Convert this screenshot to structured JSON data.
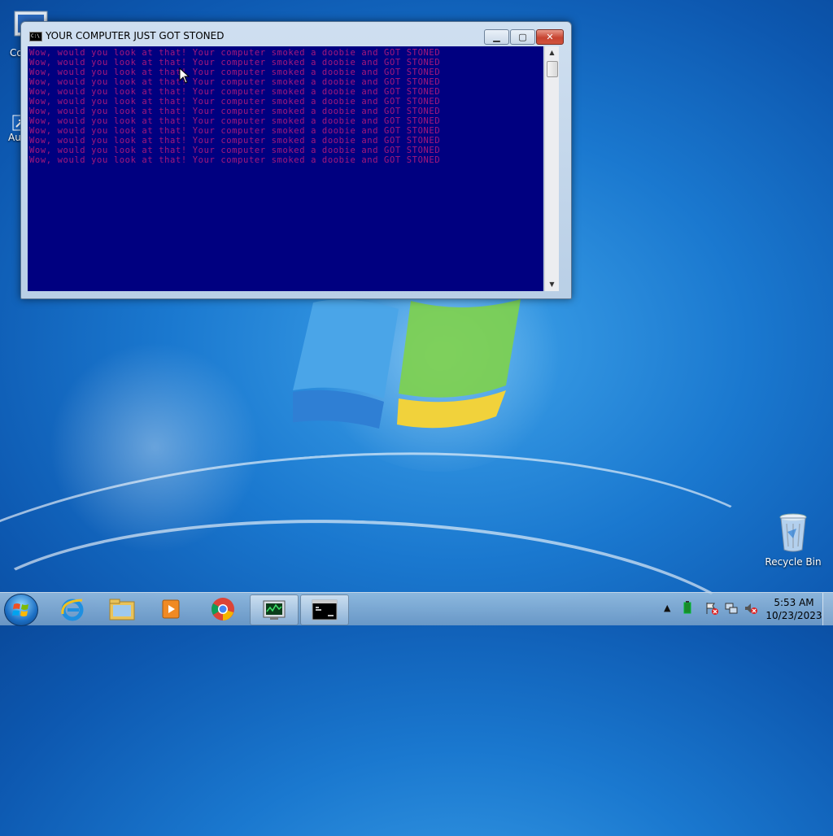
{
  "desktop": {
    "icons": [
      {
        "label": "Co"
      },
      {
        "label": "Au"
      },
      {
        "label": "Recycle Bin"
      }
    ]
  },
  "window": {
    "title": "YOUR COMPUTER JUST GOT STONED",
    "console_text_color": "#a4187c",
    "console_bg_color": "#000080",
    "lines": [
      "Wow, would you look at that! Your computer smoked a doobie and GOT STONED",
      "Wow, would you look at that! Your computer smoked a doobie and GOT STONED",
      "Wow, would you look at that! Your computer smoked a doobie and GOT STONED",
      "Wow, would you look at that! Your computer smoked a doobie and GOT STONED",
      "Wow, would you look at that! Your computer smoked a doobie and GOT STONED",
      "Wow, would you look at that! Your computer smoked a doobie and GOT STONED",
      "Wow, would you look at that! Your computer smoked a doobie and GOT STONED",
      "Wow, would you look at that! Your computer smoked a doobie and GOT STONED",
      "Wow, would you look at that! Your computer smoked a doobie and GOT STONED",
      "Wow, would you look at that! Your computer smoked a doobie and GOT STONED",
      "Wow, would you look at that! Your computer smoked a doobie and GOT STONED",
      "Wow, would you look at that! Your computer smoked a doobie and GOT STONED"
    ],
    "controls": {
      "minimize_icon": "minimize-icon",
      "maximize_icon": "maximize-icon",
      "close_icon": "close-icon"
    }
  },
  "taskbar": {
    "items": [
      {
        "name": "internet-explorer-icon"
      },
      {
        "name": "file-explorer-icon"
      },
      {
        "name": "media-player-icon"
      },
      {
        "name": "chrome-icon"
      },
      {
        "name": "task-manager-icon"
      },
      {
        "name": "command-prompt-icon"
      }
    ],
    "clock": {
      "time": "5:53 AM",
      "date": "10/23/2023"
    }
  }
}
